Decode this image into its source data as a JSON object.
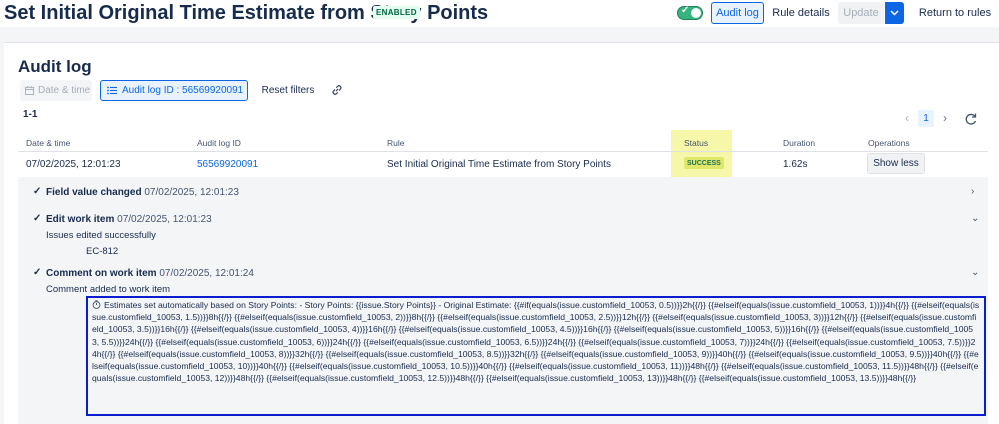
{
  "header": {
    "title": "Set Initial Original Time Estimate from Story Points",
    "badge": "ENABLED",
    "toggle_on": true,
    "audit_log_label": "Audit log",
    "rule_details_label": "Rule details",
    "update_label": "Update",
    "return_label": "Return to rules"
  },
  "page": {
    "heading": "Audit log",
    "filters": {
      "date_time": "Date & time",
      "audit_log_id": "Audit log ID : 56569920091",
      "reset": "Reset filters"
    },
    "count": "1-1",
    "pagination": {
      "current": "1"
    }
  },
  "table": {
    "columns": [
      "Date & time",
      "Audit log ID",
      "Rule",
      "Status",
      "Duration",
      "Operations"
    ],
    "row": {
      "datetime": "07/02/2025, 12:01:23",
      "audit_id": "56569920091",
      "rule": "Set Initial Original Time Estimate from Story Points",
      "status": "SUCCESS",
      "duration": "1.62s",
      "operation": "Show less"
    }
  },
  "details": {
    "events": [
      {
        "title": "Field value changed",
        "time": "07/02/2025, 12:01:23"
      },
      {
        "title": "Edit work item",
        "time": "07/02/2025, 12:01:23"
      },
      {
        "title": "Comment on work item",
        "time": "07/02/2025, 12:01:24"
      }
    ],
    "edit_message": "Issues edited successfully",
    "edited_issue": "EC-812",
    "comment_message": "Comment added to work item",
    "comment_text": "Estimates set automatically based on Story Points: - Story Points: {{issue.Story Points}} - Original Estimate: {{#if(equals(issue.customfield_10053, 0.5))}}2h{{/}} {{#elseif(equals(issue.customfield_10053, 1))}}4h{{/}} {{#elseif(equals(issue.customfield_10053, 1.5))}}8h{{/}} {{#elseif(equals(issue.customfield_10053, 2))}}8h{{/}} {{#elseif(equals(issue.customfield_10053, 2.5))}}12h{{/}} {{#elseif(equals(issue.customfield_10053, 3))}}12h{{/}} {{#elseif(equals(issue.customfield_10053, 3.5))}}16h{{/}} {{#elseif(equals(issue.customfield_10053, 4))}}16h{{/}} {{#elseif(equals(issue.customfield_10053, 4.5))}}16h{{/}} {{#elseif(equals(issue.customfield_10053, 5))}}16h{{/}} {{#elseif(equals(issue.customfield_10053, 5.5))}}24h{{/}} {{#elseif(equals(issue.customfield_10053, 6))}}24h{{/}} {{#elseif(equals(issue.customfield_10053, 6.5))}}24h{{/}} {{#elseif(equals(issue.customfield_10053, 7))}}24h{{/}} {{#elseif(equals(issue.customfield_10053, 7.5))}}24h{{/}} {{#elseif(equals(issue.customfield_10053, 8))}}32h{{/}} {{#elseif(equals(issue.customfield_10053, 8.5))}}32h{{/}} {{#elseif(equals(issue.customfield_10053, 9))}}40h{{/}} {{#elseif(equals(issue.customfield_10053, 9.5))}}40h{{/}} {{#elseif(equals(issue.customfield_10053, 10))}}40h{{/}} {{#elseif(equals(issue.customfield_10053, 10.5))}}40h{{/}} {{#elseif(equals(issue.customfield_10053, 11))}}48h{{/}} {{#elseif(equals(issue.customfield_10053, 11.5))}}48h{{/}} {{#elseif(equals(issue.customfield_10053, 12))}}48h{{/}} {{#elseif(equals(issue.customfield_10053, 12.5))}}48h{{/}} {{#elseif(equals(issue.customfield_10053, 13))}}48h{{/}} {{#elseif(equals(issue.customfield_10053, 13.5))}}48h{{/}}"
  },
  "colors": {
    "primary": "#0c66e4",
    "success_toggle": "#36b37e",
    "status_highlight": "#f6f7a8",
    "comment_border": "#0a1ecf"
  },
  "icons": [
    "calendar-icon",
    "list-icon",
    "link-icon",
    "refresh-icon",
    "chevron-left-icon",
    "chevron-right-icon",
    "chevron-down-icon",
    "check-icon",
    "timer-icon"
  ]
}
